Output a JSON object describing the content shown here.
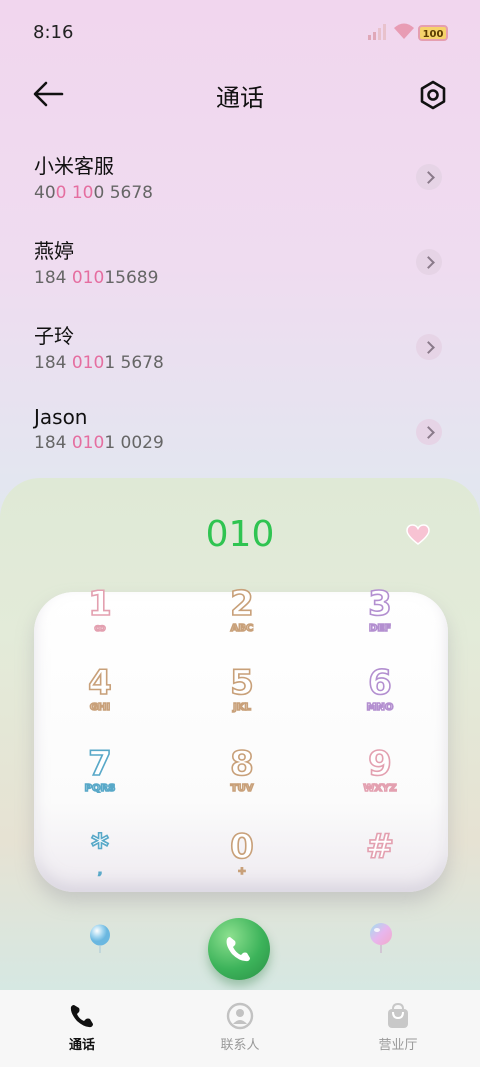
{
  "status": {
    "time": "8:16",
    "battery": "100"
  },
  "header": {
    "title": "通话"
  },
  "contacts": [
    {
      "name": "小米客服",
      "num_pre": "40",
      "num_hl": "0 10",
      "num_post": "0 5678"
    },
    {
      "name": "燕婷",
      "num_pre": "184 ",
      "num_hl": "010",
      "num_post": "15689"
    },
    {
      "name": "子玲",
      "num_pre": "184 ",
      "num_hl": "010",
      "num_post": "1 5678"
    },
    {
      "name": "Jason",
      "num_pre": "184 ",
      "num_hl": "010",
      "num_post": "1 0029"
    }
  ],
  "dialer": {
    "input": "010",
    "keys": [
      {
        "num": "1",
        "sub": "ꝏ"
      },
      {
        "num": "2",
        "sub": "ABC"
      },
      {
        "num": "3",
        "sub": "DEF"
      },
      {
        "num": "4",
        "sub": "GHI"
      },
      {
        "num": "5",
        "sub": "JKL"
      },
      {
        "num": "6",
        "sub": "MNO"
      },
      {
        "num": "7",
        "sub": "PQRS"
      },
      {
        "num": "8",
        "sub": "TUV"
      },
      {
        "num": "9",
        "sub": "WXYZ"
      },
      {
        "num": "*",
        "sub": ","
      },
      {
        "num": "0",
        "sub": "+"
      },
      {
        "num": "#",
        "sub": ""
      }
    ]
  },
  "tabs": [
    {
      "label": "通话",
      "icon": "phone-icon",
      "active": true
    },
    {
      "label": "联系人",
      "icon": "person-icon",
      "active": false
    },
    {
      "label": "营业厅",
      "icon": "bag-icon",
      "active": false
    }
  ],
  "colors": {
    "accent_green": "#2fc451",
    "highlight_pink": "#e56ea0"
  }
}
